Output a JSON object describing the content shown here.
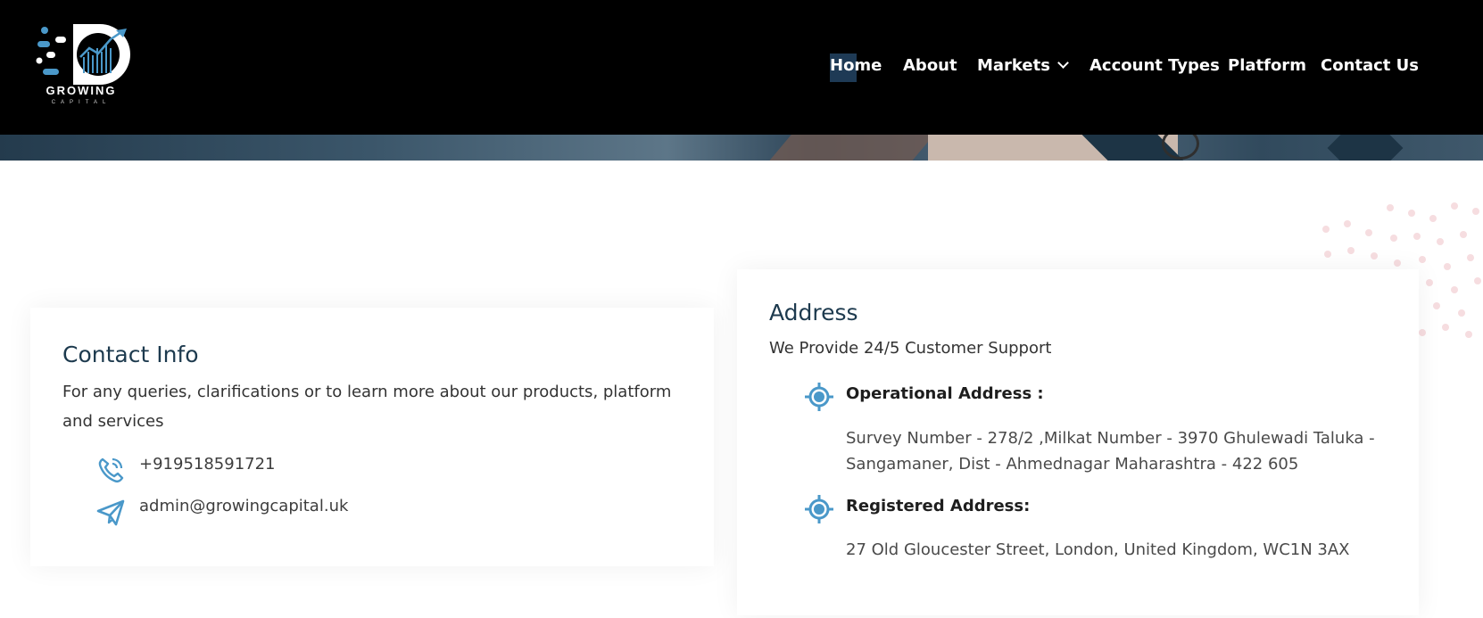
{
  "brand": {
    "name": "GROWING",
    "sub": "CAPITAL"
  },
  "nav": [
    {
      "label": "Home",
      "active": true
    },
    {
      "label": "About"
    },
    {
      "label": "Markets",
      "has_dropdown": true
    },
    {
      "label": "Account Types"
    },
    {
      "label": "Platform"
    },
    {
      "label": "Contact Us"
    }
  ],
  "contact": {
    "title": "Contact Info",
    "description": "For any queries, clarifications or to learn more about our products, platform and services",
    "phone": "+919518591721",
    "email": "admin@growingcapital.uk"
  },
  "address": {
    "title": "Address",
    "subtitle": "We Provide 24/5 Customer Support",
    "operational_label": "Operational Address :",
    "operational_value": "Survey Number - 278/2 ,Milkat Number - 3970 Ghulewadi Taluka - Sangamaner, Dist - Ahmednagar Maharashtra - 422 605",
    "registered_label": "Registered Address:",
    "registered_value": "27 Old Gloucester Street, London, United Kingdom, WC1N 3AX"
  },
  "icons": {
    "phone": "phone-icon",
    "email": "send-icon",
    "location": "location-target-icon"
  },
  "colors": {
    "accent": "#4a98c9",
    "heading": "#1d3a4e",
    "header_bg": "#000000"
  }
}
